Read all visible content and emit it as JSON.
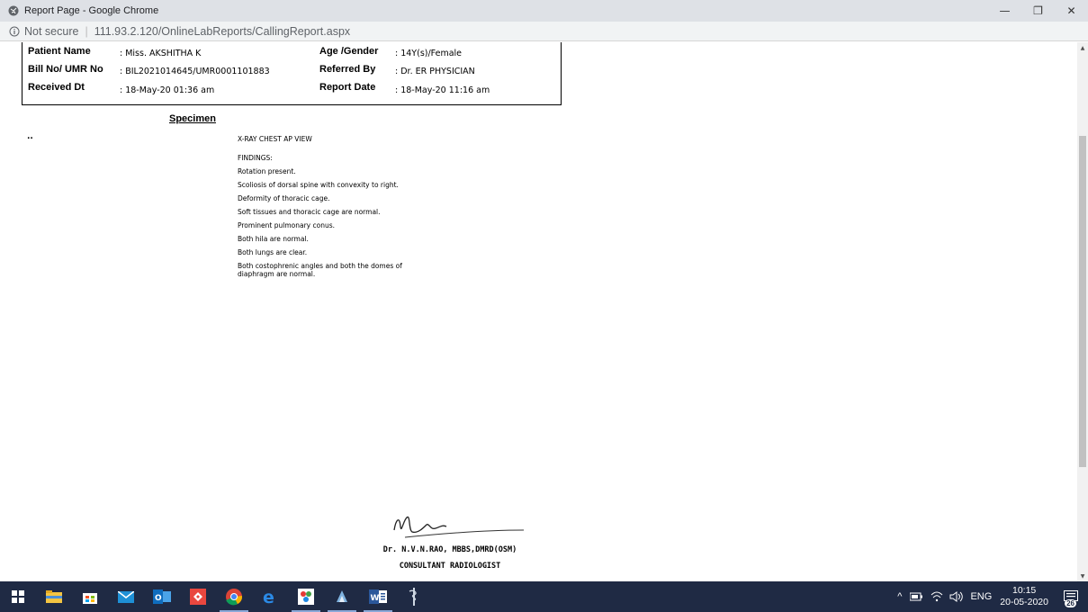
{
  "window": {
    "title": "Report Page - Google Chrome",
    "controls": {
      "minimize": "—",
      "restore": "❐",
      "close": "✕"
    }
  },
  "addressbar": {
    "security": "Not secure",
    "separator": "|",
    "url": "111.93.2.120/OnlineLabReports/CallingReport.aspx"
  },
  "patient": {
    "name_label": "Patient Name",
    "name_value": ": Miss. AKSHITHA K",
    "age_label": "Age /Gender",
    "age_value": ": 14Y(s)/Female",
    "bill_label": "Bill No/ UMR No",
    "bill_value": ": BIL2021014645/UMR0001101883",
    "referred_label": "Referred By",
    "referred_value": ": Dr. ER PHYSICIAN",
    "received_label": "Received Dt",
    "received_value": ": 18-May-20  01:36 am",
    "report_date_label": "Report Date",
    "report_date_value": ": 18-May-20  11:16 am"
  },
  "report": {
    "specimen_heading": "Specimen",
    "specimen_marker": "..",
    "exam": "X-RAY CHEST AP VIEW",
    "findings_heading": "FINDINGS:",
    "findings": [
      "Rotation present.",
      "Scoliosis of dorsal spine with convexity to right.",
      "Deformity of thoracic cage.",
      "Soft tissues and thoracic cage are normal.",
      "Prominent pulmonary conus.",
      "Both hila are normal.",
      "Both lungs are clear."
    ],
    "last_finding_line1": "Both costophrenic angles and both the domes of",
    "last_finding_line2": "diaphragm are normal."
  },
  "doctor": {
    "name": "Dr. N.V.N.RAO, MBBS,DMRD(OSM)",
    "title": "CONSULTANT RADIOLOGIST"
  },
  "taskbar": {
    "apps": [
      "windows-start",
      "file-explorer",
      "store",
      "mail",
      "outlook",
      "anydesk",
      "chrome",
      "edge",
      "paint",
      "app",
      "word",
      "medical-app"
    ],
    "tray": {
      "caret": "^",
      "language": "ENG",
      "time": "10:15",
      "date": "20-05-2020",
      "notifications": "26"
    }
  }
}
